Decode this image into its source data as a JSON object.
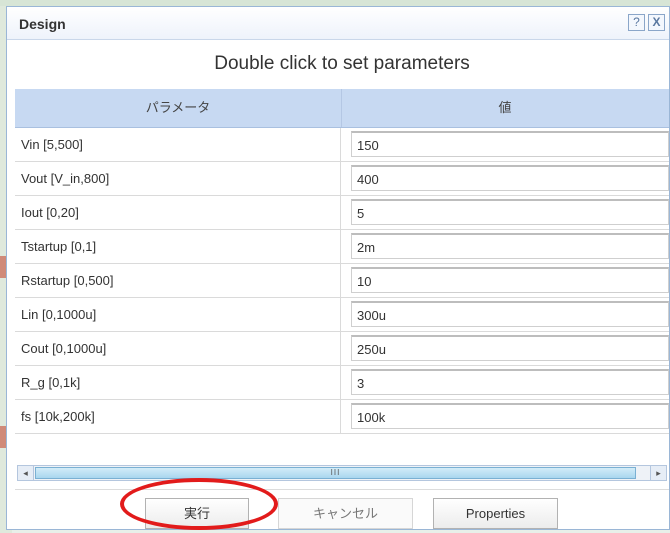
{
  "window": {
    "title": "Design",
    "help_label": "?",
    "close_label": "X"
  },
  "header": {
    "title": "Double click to set parameters"
  },
  "grid": {
    "columns": [
      "パラメータ",
      "値"
    ],
    "rows": [
      {
        "name": "Vin [5,500]",
        "value": "150"
      },
      {
        "name": "Vout [V_in,800]",
        "value": "400"
      },
      {
        "name": "Iout [0,20]",
        "value": "5"
      },
      {
        "name": "Tstartup [0,1]",
        "value": "2m"
      },
      {
        "name": "Rstartup [0,500]",
        "value": "10"
      },
      {
        "name": "Lin [0,1000u]",
        "value": "300u"
      },
      {
        "name": "Cout [0,1000u]",
        "value": "250u"
      },
      {
        "name": "R_g [0,1k]",
        "value": "3"
      },
      {
        "name": "fs [10k,200k]",
        "value": "100k"
      }
    ]
  },
  "scrollbar": {
    "left_arrow": "◂",
    "right_arrow": "▸",
    "grip": "III"
  },
  "buttons": {
    "run": "実行",
    "cancel": "キャンセル",
    "properties": "Properties"
  },
  "colors": {
    "accent": "#c7d9f2",
    "annotation": "#e21b1b"
  }
}
